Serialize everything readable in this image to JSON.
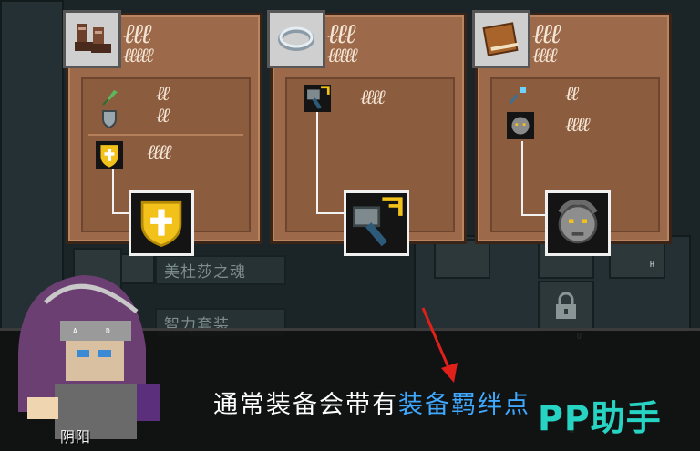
{
  "background": {
    "labels": [
      "美杜莎之魂",
      "智力套装"
    ],
    "hint_keys": [
      "H",
      "U",
      "K",
      "A",
      "D"
    ]
  },
  "cards": [
    {
      "icon": "boots-icon",
      "rows": [
        "feather-icon",
        "shield-icon",
        "holy-shield-icon"
      ],
      "set_item_icon": "holy-shield-icon"
    },
    {
      "icon": "ring-icon",
      "rows": [
        "hammer-icon"
      ],
      "set_item_icon": "hammer-icon"
    },
    {
      "icon": "book-icon",
      "rows": [
        "staff-icon",
        "gorgon-head-icon"
      ],
      "set_item_icon": "gorgon-head-icon"
    }
  ],
  "dialog": {
    "text_before": "通常装备会带有",
    "text_highlight": "装备羁绊点",
    "speaker": "阴阳"
  },
  "watermark": "PP助手",
  "colors": {
    "card": "#9c6a4a",
    "highlight_text": "#3fa8ff",
    "watermark": "#27d3c3",
    "arrow": "#e0201a"
  }
}
